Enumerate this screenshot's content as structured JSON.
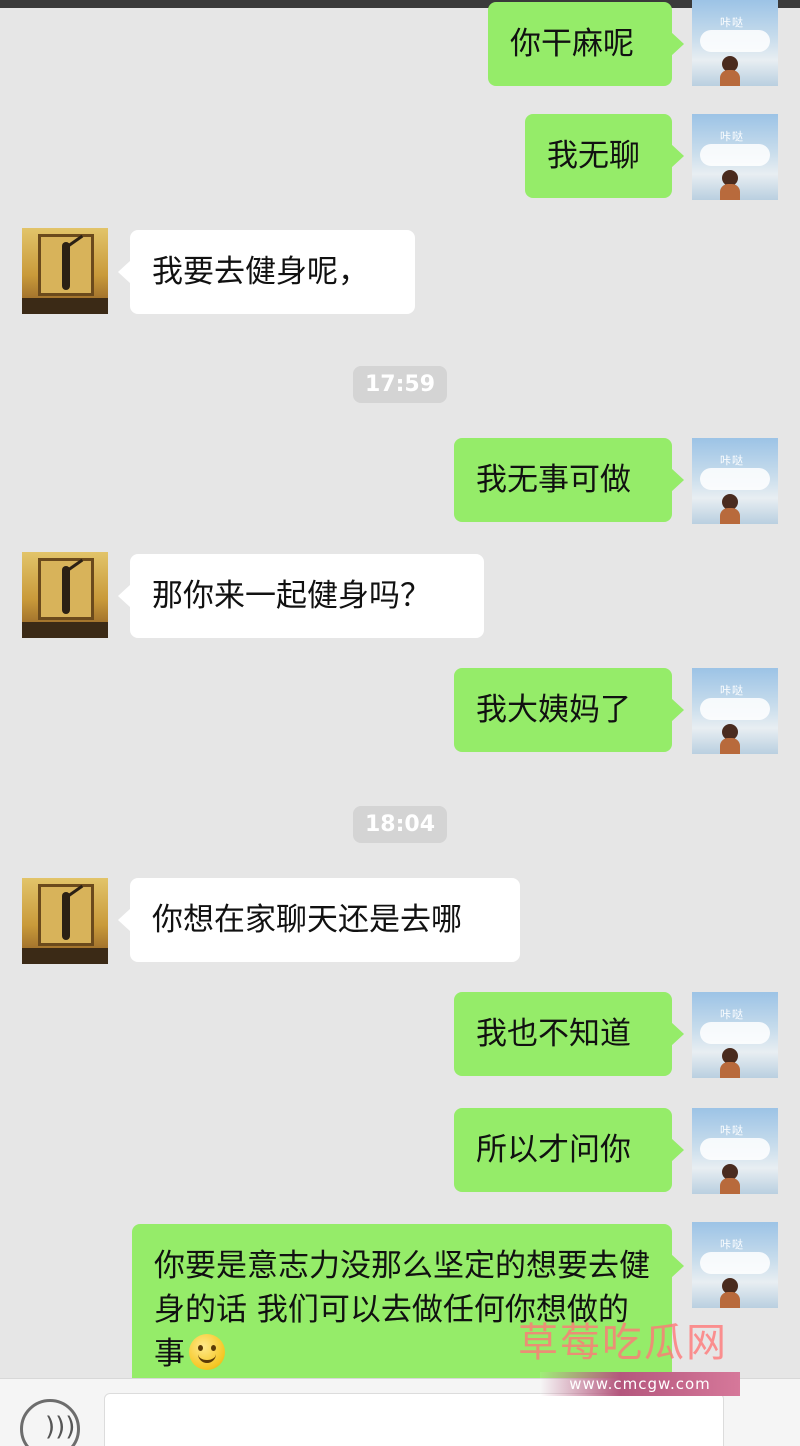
{
  "messages": [
    {
      "text": "你干麻呢"
    },
    {
      "text": "我无聊"
    },
    {
      "text": "我要去健身呢，"
    },
    {
      "text": "我无事可做"
    },
    {
      "text": "那你来一起健身吗？"
    },
    {
      "text": "我大姨妈了"
    },
    {
      "text": "你想在家聊天还是去哪"
    },
    {
      "text": "我也不知道"
    },
    {
      "text": "所以才问你"
    },
    {
      "text": "你要是意志力没那么坚定的想要去健身的话 我们可以去做任何你想做的事"
    }
  ],
  "timestamps": [
    "17:59",
    "18:04"
  ],
  "my_avatar_caption": "咔哒",
  "watermark": {
    "title": "草莓吃瓜网",
    "url": "www.cmcgw.com"
  },
  "colors": {
    "my_bubble": "#95ec69",
    "their_bubble": "#ffffff",
    "background": "#e6e6e6"
  }
}
